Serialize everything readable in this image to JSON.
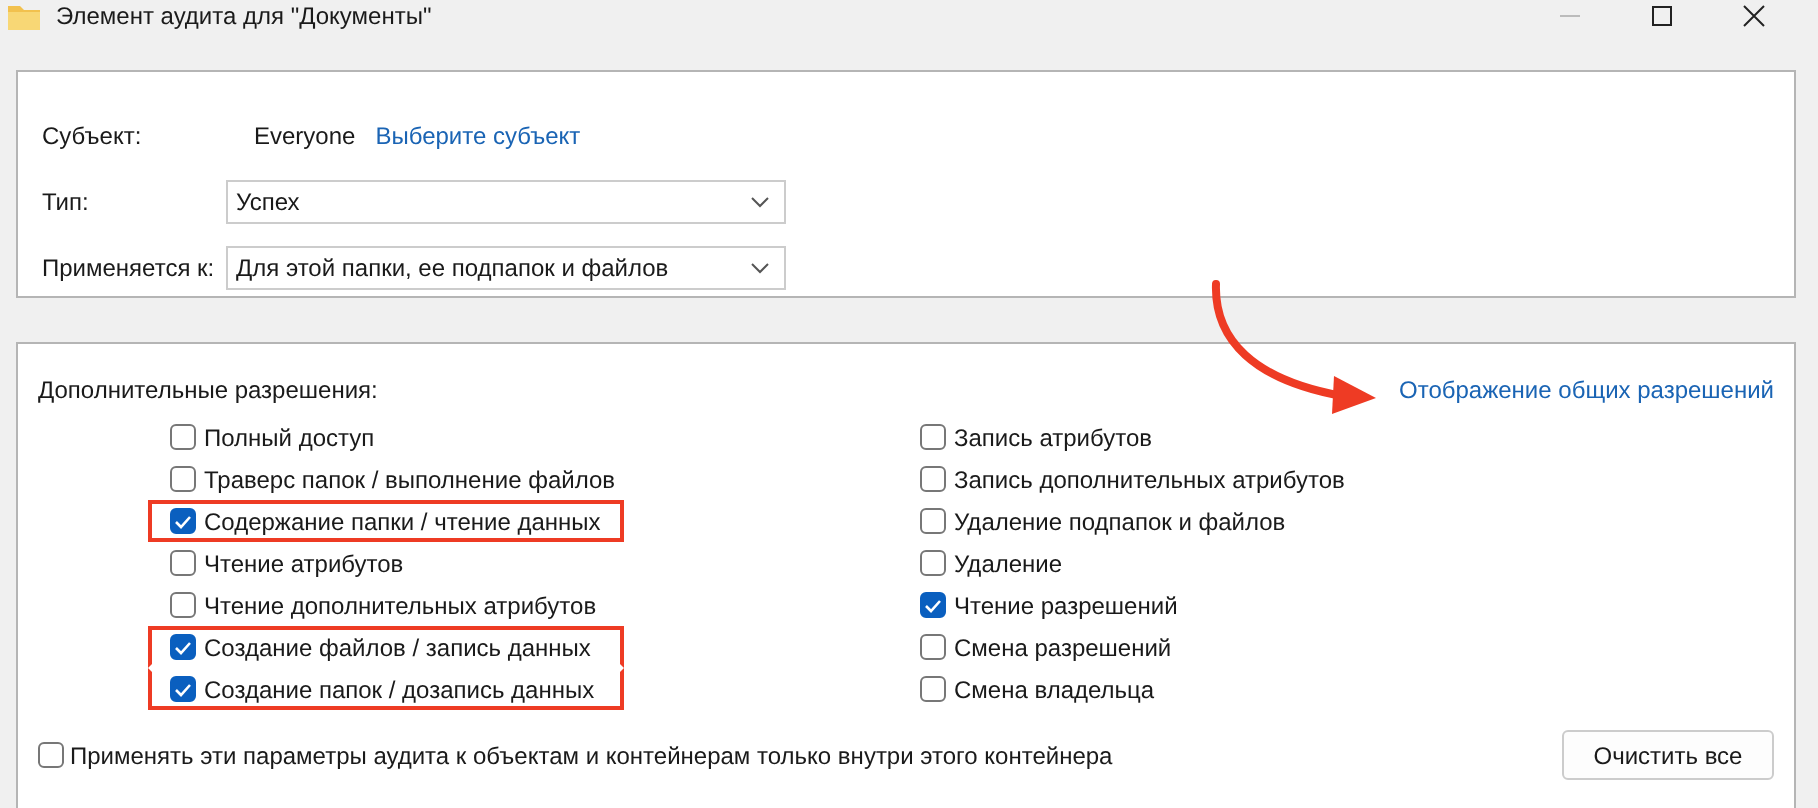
{
  "window": {
    "title": "Элемент аудита для \"Документы\""
  },
  "subject": {
    "label": "Субъект:",
    "value": "Everyone",
    "link": "Выберите субъект"
  },
  "type": {
    "label": "Тип:",
    "value": "Успех"
  },
  "applies_to": {
    "label": "Применяется к:",
    "value": "Для этой папки, ее подпапок и файлов"
  },
  "permissions": {
    "title": "Дополнительные разрешения:",
    "link": "Отображение общих разрешений",
    "left_column": [
      {
        "label": "Полный доступ",
        "checked": false,
        "highlighted": false
      },
      {
        "label": "Траверс папок / выполнение файлов",
        "checked": false,
        "highlighted": false
      },
      {
        "label": "Содержание папки / чтение данных",
        "checked": true,
        "highlighted": true
      },
      {
        "label": "Чтение атрибутов",
        "checked": false,
        "highlighted": false
      },
      {
        "label": "Чтение дополнительных атрибутов",
        "checked": false,
        "highlighted": false
      },
      {
        "label": "Создание файлов / запись данных",
        "checked": true,
        "highlighted": true
      },
      {
        "label": "Создание папок / дозапись данных",
        "checked": true,
        "highlighted": true
      }
    ],
    "right_column": [
      {
        "label": "Запись атрибутов",
        "checked": false,
        "highlighted": false
      },
      {
        "label": "Запись дополнительных атрибутов",
        "checked": false,
        "highlighted": false
      },
      {
        "label": "Удаление подпапок и файлов",
        "checked": false,
        "highlighted": false
      },
      {
        "label": "Удаление",
        "checked": false,
        "highlighted": false
      },
      {
        "label": "Чтение разрешений",
        "checked": true,
        "highlighted": false
      },
      {
        "label": "Смена разрешений",
        "checked": false,
        "highlighted": false
      },
      {
        "label": "Смена владельца",
        "checked": false,
        "highlighted": false
      }
    ]
  },
  "container_only": {
    "label": "Применять эти параметры аудита к объектам и контейнерам только внутри этого контейнера",
    "checked": false
  },
  "buttons": [
    "Очистить все"
  ]
}
